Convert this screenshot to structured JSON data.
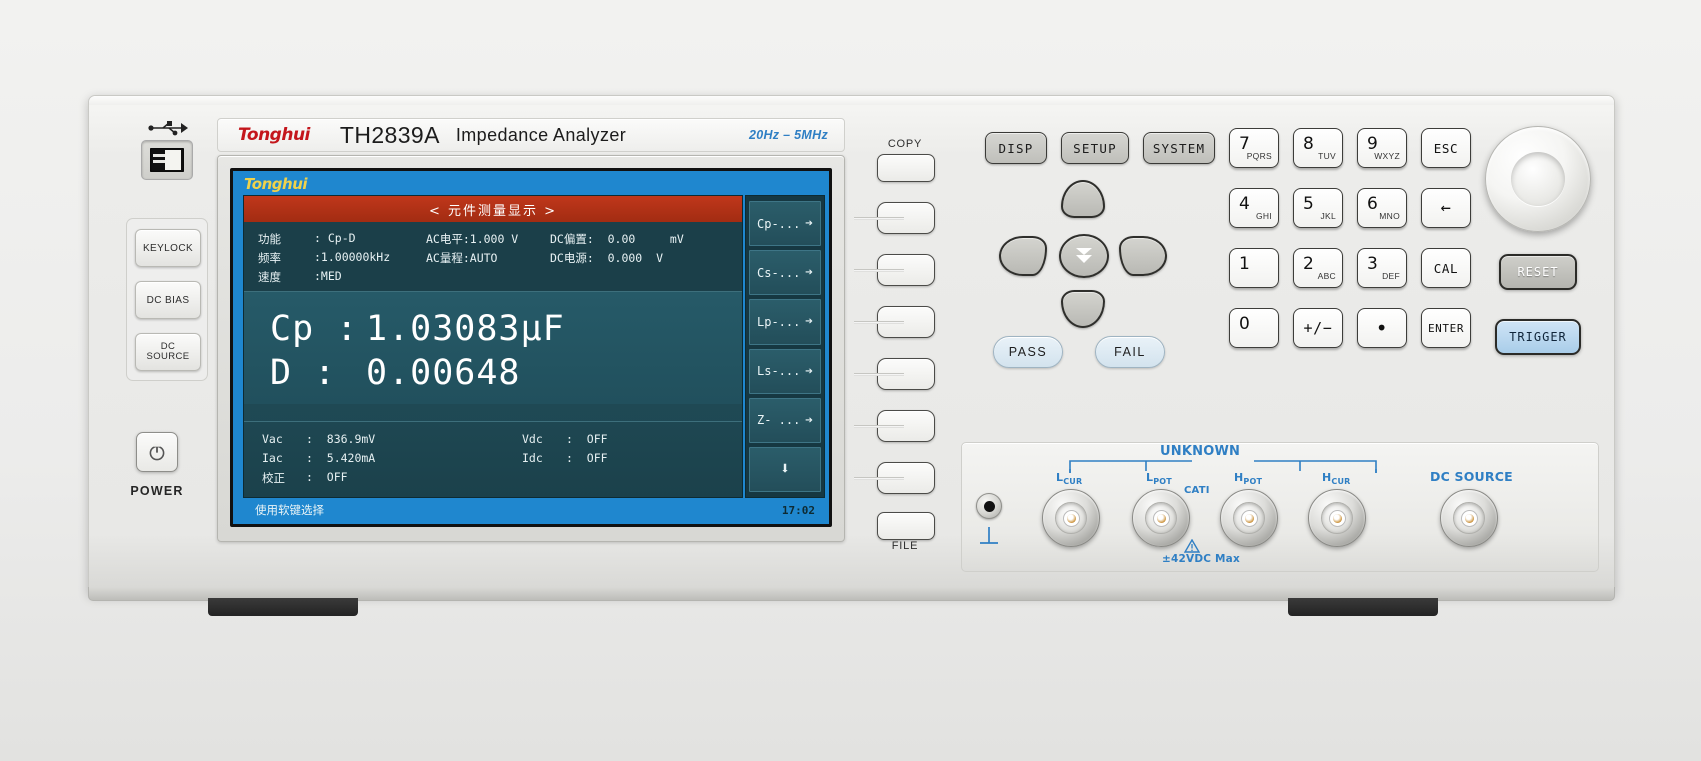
{
  "instrument": {
    "brand": "Tonghui",
    "model": "TH2839A",
    "description": "Impedance  Analyzer",
    "freq_range": "20Hz – 5MHz",
    "power_label": "POWER",
    "usb_icon": "usb-icon",
    "power_icon": "power-icon"
  },
  "left_buttons": [
    {
      "label": "KEYLOCK",
      "name": "keylock-button"
    },
    {
      "label": "DC BIAS",
      "name": "dc-bias-button"
    },
    {
      "label": "DC\nSOURCE",
      "name": "dc-source-button"
    }
  ],
  "lcd": {
    "brand": "Tonghui",
    "title": "< 元件测量显示 >",
    "params": [
      {
        "label": "功能",
        "value": ": Cp-D",
        "mid": "AC电平:1.000 V",
        "right": "DC偏置:  0.00     mV"
      },
      {
        "label": "频率",
        "value": ":1.00000kHz",
        "mid": "AC量程:AUTO",
        "right": "DC电源:  0.000  V"
      },
      {
        "label": "速度",
        "value": ":MED",
        "mid": "",
        "right": ""
      }
    ],
    "primary": [
      {
        "label": "Cp :",
        "value": "1.03083μF"
      },
      {
        "label": "D  :",
        "value": "0.00648"
      }
    ],
    "secondary": [
      {
        "label": "Vac",
        "value": ":  836.9mV",
        "label2": "Vdc",
        "value2": ":  OFF"
      },
      {
        "label": "Iac",
        "value": ":  5.420mA",
        "label2": "Idc",
        "value2": ":  OFF"
      },
      {
        "label": "校正",
        "value": ":  OFF",
        "label2": "",
        "value2": ""
      }
    ],
    "status_text": "使用软键选择",
    "clock": "17:02",
    "softkeys": [
      {
        "label": "Cp-...",
        "arrow": "➔"
      },
      {
        "label": "Cs-...",
        "arrow": "➔"
      },
      {
        "label": "Lp-...",
        "arrow": "➔"
      },
      {
        "label": "Ls-...",
        "arrow": "➔"
      },
      {
        "label": "Z- ...",
        "arrow": "➔"
      },
      {
        "label": "⬇",
        "arrow": ""
      }
    ]
  },
  "softkey_hw": {
    "copy_label": "COPY",
    "file_label": "FILE"
  },
  "control_buttons": [
    {
      "label": "DISP",
      "name": "disp-button"
    },
    {
      "label": "SETUP",
      "name": "setup-button"
    },
    {
      "label": "SYSTEM",
      "name": "system-button"
    }
  ],
  "arrow_pad": {
    "up": "up-arrow-key",
    "down": "down-arrow-key",
    "left": "left-arrow-key",
    "right": "right-arrow-key",
    "center_icon": "double-down-arrow-icon"
  },
  "pass_fail": [
    {
      "label": "PASS",
      "name": "pass-indicator"
    },
    {
      "label": "FAIL",
      "name": "fail-indicator"
    }
  ],
  "keypad": [
    {
      "digit": "7",
      "sub": "PQRS",
      "type": "num"
    },
    {
      "digit": "8",
      "sub": "TUV",
      "type": "num"
    },
    {
      "digit": "9",
      "sub": "WXYZ",
      "type": "num"
    },
    {
      "digit": "ESC",
      "sub": "",
      "type": "fn"
    },
    {
      "digit": "4",
      "sub": "GHI",
      "type": "num"
    },
    {
      "digit": "5",
      "sub": "JKL",
      "type": "num"
    },
    {
      "digit": "6",
      "sub": "MNO",
      "type": "num"
    },
    {
      "digit": "←",
      "sub": "",
      "type": "fn"
    },
    {
      "digit": "1",
      "sub": "",
      "type": "num"
    },
    {
      "digit": "2",
      "sub": "ABC",
      "type": "num"
    },
    {
      "digit": "3",
      "sub": "DEF",
      "type": "num"
    },
    {
      "digit": "CAL",
      "sub": "",
      "type": "fn"
    },
    {
      "digit": "0",
      "sub": "",
      "type": "num"
    },
    {
      "digit": "+/−",
      "sub": "",
      "type": "fn"
    },
    {
      "digit": "•",
      "sub": "",
      "type": "fn"
    },
    {
      "digit": "ENTER",
      "sub": "",
      "type": "fn"
    }
  ],
  "right_controls": {
    "knob": "rotary-knob",
    "reset_label": "RESET",
    "trigger_label": "TRIGGER",
    "trigger_color": "#a9cde9"
  },
  "connectors": {
    "unknown_label": "UNKNOWN",
    "cat_label": "CATⅠ",
    "warning_label": "±42VDC Max",
    "dc_source_label": "DC SOURCE",
    "terminals": [
      {
        "label": "L",
        "sub": "CUR"
      },
      {
        "label": "L",
        "sub": "POT"
      },
      {
        "label": "H",
        "sub": "POT"
      },
      {
        "label": "H",
        "sub": "CUR"
      }
    ],
    "ground_icon": "ground-terminal-icon",
    "label_color": "#2f7fc4"
  }
}
